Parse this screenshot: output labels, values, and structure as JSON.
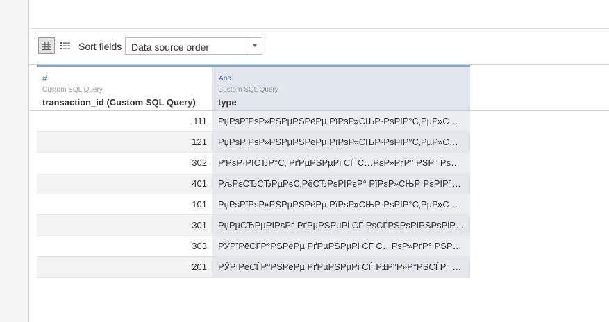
{
  "toolbar": {
    "sort_label": "Sort fields",
    "sort_value": "Data source order",
    "grid_icon": "grid-view-icon",
    "list_icon": "list-view-icon"
  },
  "columns": [
    {
      "type_icon": "#",
      "source": "Custom SQL Query",
      "name": "transaction_id (Custom SQL Query)"
    },
    {
      "type_icon": "Abc",
      "source": "Custom SQL Query",
      "name": "type"
    }
  ],
  "rows": [
    {
      "transaction_id": "111",
      "type": "РџРѕРїРѕР»РЅРµРЅРёРµ РїРѕР»СЊР·РѕРІР°С‚РµР»СЊСЃРєР..."
    },
    {
      "transaction_id": "121",
      "type": "РџРѕРїРѕР»РЅРµРЅРёРµ РїРѕР»СЊР·РѕРІР°С‚РµР»СЊСЃРєР..."
    },
    {
      "transaction_id": "302",
      "type": "Р'РѕР·РІСЂР°С‚ РґРµРЅРµРі СЃ С…РѕР»РґР° РЅР° РѕСЃРЅРѕРІ..."
    },
    {
      "transaction_id": "401",
      "type": "РљРѕСЂСЂРµРєС‚РёСЂРѕРІРєР° РїРѕР»СЊР·РѕРІР°С‚РµР»..."
    },
    {
      "transaction_id": "101",
      "type": "РџРѕРїРѕР»РЅРµРЅРёРµ РїРѕР»СЊР·РѕРІР°С‚РµР»СЊСЃРєР..."
    },
    {
      "transaction_id": "301",
      "type": "РџРµСЂРµРІРѕРґ РґРµРЅРµРі СЃ РѕСЃРЅРѕРІРЅРѕРіРѕ СЃС‡Р..."
    },
    {
      "transaction_id": "303",
      "type": "РЎРїРёСЃР°РЅРёРµ РґРµРЅРµРі СЃ С…РѕР»РґР° РЅР° СЃРёСЃ..."
    },
    {
      "transaction_id": "201",
      "type": "РЎРїРёСЃР°РЅРёРµ РґРµРЅРµРі СЃ Р±Р°Р»Р°РЅСЃР° РїРѕР»С..."
    }
  ]
}
